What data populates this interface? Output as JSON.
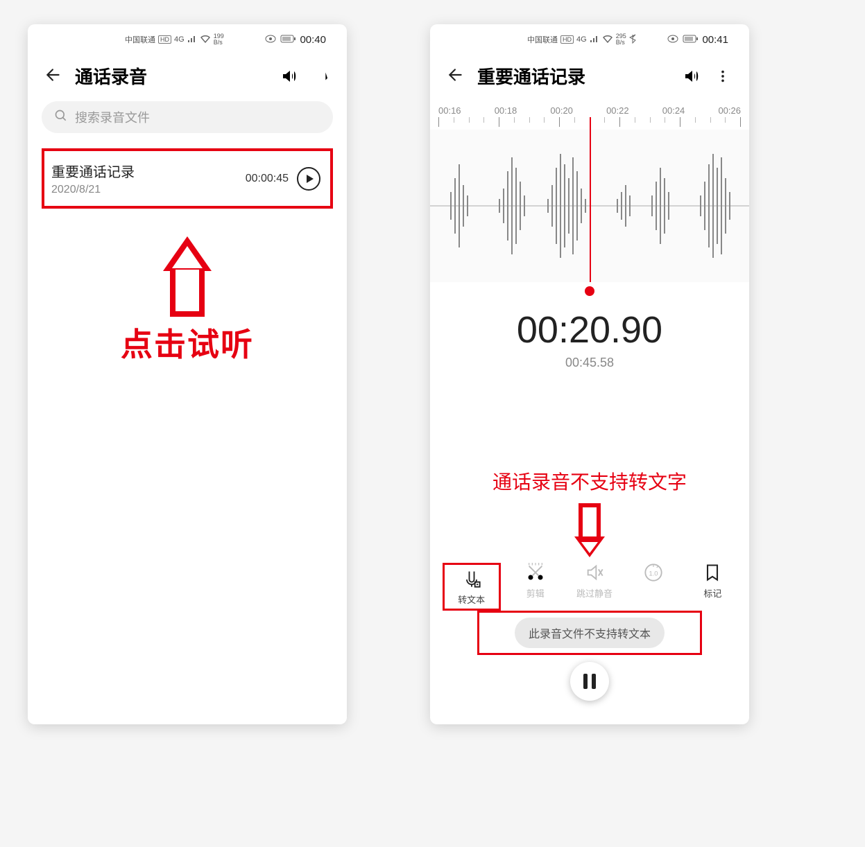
{
  "left": {
    "status": {
      "carrier": "中国联通",
      "hd": "HD",
      "net": "4G",
      "speed_num": "199",
      "speed_unit": "B/s",
      "time": "00:40"
    },
    "header": {
      "title": "通话录音"
    },
    "search": {
      "placeholder": "搜索录音文件"
    },
    "item": {
      "title": "重要通话记录",
      "date": "2020/8/21",
      "duration": "00:00:45"
    },
    "annotation": "点击试听"
  },
  "right": {
    "status": {
      "carrier": "中国联通",
      "hd": "HD",
      "net": "4G",
      "speed_num": "295",
      "speed_unit": "B/s",
      "time": "00:41"
    },
    "header": {
      "title": "重要通话记录"
    },
    "ruler": [
      "00:16",
      "00:18",
      "00:20",
      "00:22",
      "00:24",
      "00:26"
    ],
    "current": "00:20.90",
    "total": "00:45.58",
    "annotation": "通话录音不支持转文字",
    "tools": {
      "to_text": "转文本",
      "trim": "剪辑",
      "mute": "跳过静音",
      "speed": "1.0",
      "bookmark": "标记"
    },
    "toast": "此录音文件不支持转文本"
  }
}
